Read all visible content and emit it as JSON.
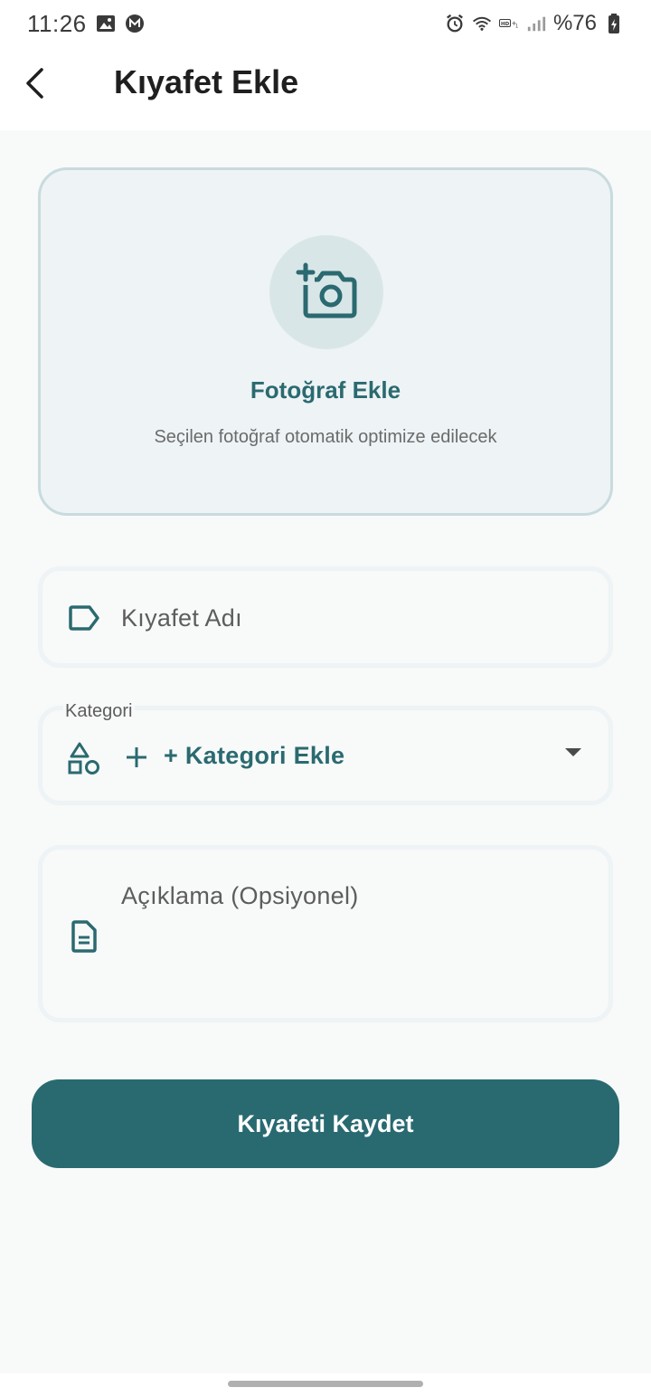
{
  "status_bar": {
    "time": "11:26",
    "battery": "%76",
    "icons": [
      "gallery-icon",
      "m-icon",
      "alarm-icon",
      "wifi-icon",
      "hd-icon",
      "signal-icon",
      "battery-icon"
    ]
  },
  "header": {
    "title": "Kıyafet Ekle",
    "back_icon": "chevron-left-icon"
  },
  "photo": {
    "title": "Fotoğraf Ekle",
    "subtitle": "Seçilen fotoğraf otomatik optimize edilecek",
    "icon": "add-camera-icon"
  },
  "fields": {
    "name_placeholder": "Kıyafet Adı",
    "category_label": "Kategori",
    "category_value": "+ Kategori Ekle",
    "description_placeholder": "Açıklama (Opsiyonel)"
  },
  "actions": {
    "save_label": "Kıyafeti Kaydet"
  },
  "colors": {
    "accent": "#296a71",
    "accent_text": "#2a6a70",
    "card_bg": "#eef3f5",
    "card_border": "#c8dbdf",
    "page_bg": "#f8f9f9"
  }
}
